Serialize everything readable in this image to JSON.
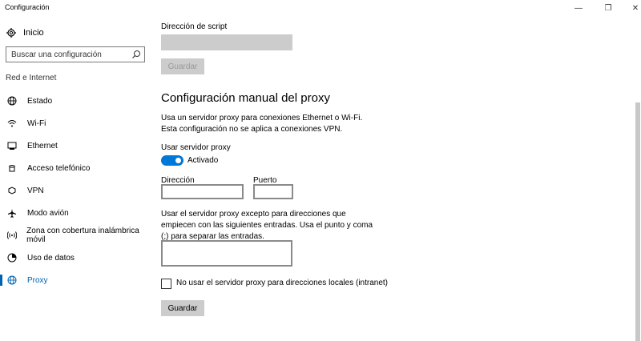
{
  "window": {
    "title": "Configuración",
    "min_glyph": "—",
    "max_glyph": "❐",
    "close_glyph": "✕"
  },
  "sidebar": {
    "home_label": "Inicio",
    "search_placeholder": "Buscar una configuración",
    "section_label": "Red e Internet",
    "items": [
      {
        "label": "Estado",
        "icon": "status-globe-icon"
      },
      {
        "label": "Wi-Fi",
        "icon": "wifi-icon"
      },
      {
        "label": "Ethernet",
        "icon": "ethernet-icon"
      },
      {
        "label": "Acceso telefónico",
        "icon": "dialup-icon"
      },
      {
        "label": "VPN",
        "icon": "vpn-icon"
      },
      {
        "label": "Modo avión",
        "icon": "airplane-icon"
      },
      {
        "label": "Zona con cobertura inalámbrica móvil",
        "icon": "hotspot-icon"
      },
      {
        "label": "Uso de datos",
        "icon": "data-usage-icon"
      },
      {
        "label": "Proxy",
        "icon": "globe-icon",
        "active": true
      }
    ]
  },
  "main": {
    "script_address_label": "Dirección de script",
    "save_disabled_label": "Guardar",
    "heading": "Configuración manual del proxy",
    "description": "Usa un servidor proxy para conexiones Ethernet o Wi-Fi. Esta configuración no se aplica a conexiones VPN.",
    "use_proxy_label": "Usar servidor proxy",
    "toggle_state": "Activado",
    "address_label": "Dirección",
    "port_label": "Puerto",
    "exceptions_text": "Usar el servidor proxy excepto para direcciones que empiecen con las siguientes entradas. Usa el punto y coma (;) para separar las entradas.",
    "checkbox_label": "No usar el servidor proxy para direcciones locales (intranet)",
    "save_label": "Guardar"
  },
  "colors": {
    "accent": "#0078d7",
    "active_nav": "#0063b1",
    "button_bg": "#cccccc"
  }
}
